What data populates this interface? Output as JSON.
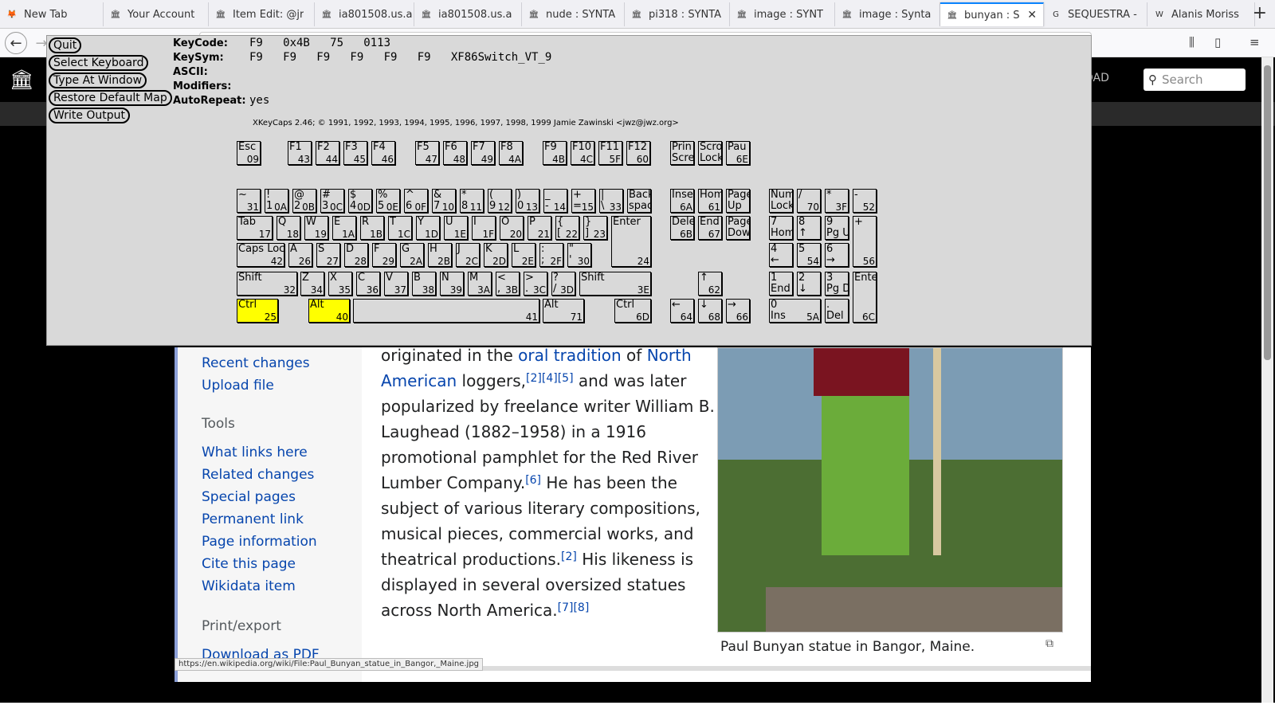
{
  "tabs": [
    {
      "label": "New Tab",
      "icon": "firefox-icon"
    },
    {
      "label": "Your Account",
      "icon": "archive-icon"
    },
    {
      "label": "Item Edit: @jr",
      "icon": "archive-icon"
    },
    {
      "label": "ia801508.us.a",
      "icon": "archive-icon"
    },
    {
      "label": "ia801508.us.a",
      "icon": "archive-icon"
    },
    {
      "label": "nude : SYNTA",
      "icon": "archive-icon"
    },
    {
      "label": "pi318 : SYNTA",
      "icon": "archive-icon"
    },
    {
      "label": "image : SYNT",
      "icon": "archive-icon"
    },
    {
      "label": "image : Synta",
      "icon": "archive-icon"
    },
    {
      "label": "bunyan : S",
      "icon": "archive-icon",
      "active": true
    },
    {
      "label": "SEQUESTRA -",
      "icon": "google-icon"
    },
    {
      "label": "Alanis Moriss",
      "icon": "wikipedia-icon"
    }
  ],
  "wiki": {
    "upload": "PLOAD",
    "search_placeholder": "Search"
  },
  "sidebar": {
    "items": [
      "Recent changes",
      "Upload file"
    ],
    "tools_heading": "Tools",
    "tools": [
      "What links here",
      "Related changes",
      "Special pages",
      "Permanent link",
      "Page information",
      "Cite this page",
      "Wikidata item"
    ],
    "print_heading": "Print/export",
    "print": [
      "Download as PDF"
    ]
  },
  "article": {
    "p1": "originated in the ",
    "l1": "oral tradition",
    "p2": " of ",
    "l2": "North American",
    "p3": " loggers,",
    "r1": "[2][4][5]",
    "p4": " and was later popularized by freelance writer William B. Laughead (1882–1958) in a 1916 promotional pamphlet for the Red River Lumber Company.",
    "r2": "[6]",
    "p5": " He has been the subject of various literary compositions, musical pieces, commercial works, and theatrical productions.",
    "r3": "[2]",
    "p6": " His likeness is displayed in several oversized statues across North America.",
    "r4": "[7][8]"
  },
  "caption": "Paul Bunyan statue in Bangor, Maine.",
  "status_url": "https://en.wikipedia.org/wiki/File:Paul_Bunyan_statue_in_Bangor,_Maine.jpg",
  "xkeycaps": {
    "buttons": [
      "Quit",
      "Select Keyboard",
      "Type At Window",
      "Restore Default Map",
      "Write Output"
    ],
    "info": [
      {
        "k": "KeyCode:",
        "v": "F9   0x4B   75   0113"
      },
      {
        "k": "KeySym:",
        "v": "F9   F9   F9   F9   F9   F9   XF86Switch_VT_9"
      },
      {
        "k": "ASCII:",
        "v": ""
      },
      {
        "k": "Modifiers:",
        "v": ""
      },
      {
        "k": "AutoRepeat:",
        "v": "yes"
      }
    ],
    "credit": "XKeyCaps 2.46; © 1991, 1992, 1993, 1994, 1995, 1996, 1997, 1998, 1999 Jamie Zawinski <jwz@jwz.org>",
    "keys": [
      {
        "l": "Esc",
        "c": "09"
      },
      {
        "l": "F1",
        "c": "43"
      },
      {
        "l": "F2",
        "c": "44"
      },
      {
        "l": "F3",
        "c": "45"
      },
      {
        "l": "F4",
        "c": "46"
      },
      {
        "l": "F5",
        "c": "47"
      },
      {
        "l": "F6",
        "c": "48"
      },
      {
        "l": "F7",
        "c": "49"
      },
      {
        "l": "F8",
        "c": "4A"
      },
      {
        "l": "F9",
        "c": "4B"
      },
      {
        "l": "F10",
        "c": "4C"
      },
      {
        "l": "F11",
        "c": "5F"
      },
      {
        "l": "F12",
        "c": "60"
      },
      {
        "l": "Prin\nScre",
        "c": ""
      },
      {
        "l": "Scro\nLock",
        "c": ""
      },
      {
        "l": "Pau",
        "c": "6E"
      },
      {
        "l": "~",
        "c": "31"
      },
      {
        "l": "!\n1",
        "c": "0A"
      },
      {
        "l": "@\n2",
        "c": "0B"
      },
      {
        "l": "#\n3",
        "c": "0C"
      },
      {
        "l": "$\n4",
        "c": "0D"
      },
      {
        "l": "%\n5",
        "c": "0E"
      },
      {
        "l": "^\n6",
        "c": "0F"
      },
      {
        "l": "&\n7",
        "c": "10"
      },
      {
        "l": "*\n8",
        "c": "11"
      },
      {
        "l": "(\n9",
        "c": "12"
      },
      {
        "l": ")\n0",
        "c": "13"
      },
      {
        "l": "_\n-",
        "c": "14"
      },
      {
        "l": "+\n=",
        "c": "15"
      },
      {
        "l": "|\n\\",
        "c": "33"
      },
      {
        "l": "Back\nspac",
        "c": ""
      },
      {
        "l": "Inse",
        "c": "6A"
      },
      {
        "l": "Hom",
        "c": "61"
      },
      {
        "l": "Page\nUp",
        "c": ""
      },
      {
        "l": "Num\nLock",
        "c": ""
      },
      {
        "l": "/",
        "c": "70"
      },
      {
        "l": "*",
        "c": "3F"
      },
      {
        "l": "-",
        "c": "52"
      },
      {
        "l": "Tab",
        "c": "17"
      },
      {
        "l": "Q",
        "c": "18"
      },
      {
        "l": "W",
        "c": "19"
      },
      {
        "l": "E",
        "c": "1A"
      },
      {
        "l": "R",
        "c": "1B"
      },
      {
        "l": "T",
        "c": "1C"
      },
      {
        "l": "Y",
        "c": "1D"
      },
      {
        "l": "U",
        "c": "1E"
      },
      {
        "l": "I",
        "c": "1F"
      },
      {
        "l": "O",
        "c": "20"
      },
      {
        "l": "P",
        "c": "21"
      },
      {
        "l": "{\n[",
        "c": "22"
      },
      {
        "l": "}\n]",
        "c": "23"
      },
      {
        "l": "Enter",
        "c": "24"
      },
      {
        "l": "Dele",
        "c": "6B"
      },
      {
        "l": "End",
        "c": "67"
      },
      {
        "l": "Page\nDow",
        "c": ""
      },
      {
        "l": "7\nHom",
        "c": ""
      },
      {
        "l": "8\n↑",
        "c": ""
      },
      {
        "l": "9\nPg U",
        "c": ""
      },
      {
        "l": "+",
        "c": "56"
      },
      {
        "l": "Caps Loc",
        "c": "42"
      },
      {
        "l": "A",
        "c": "26"
      },
      {
        "l": "S",
        "c": "27"
      },
      {
        "l": "D",
        "c": "28"
      },
      {
        "l": "F",
        "c": "29"
      },
      {
        "l": "G",
        "c": "2A"
      },
      {
        "l": "H",
        "c": "2B"
      },
      {
        "l": "J",
        "c": "2C"
      },
      {
        "l": "K",
        "c": "2D"
      },
      {
        "l": "L",
        "c": "2E"
      },
      {
        "l": ":\n;",
        "c": "2F"
      },
      {
        "l": "\"\n'",
        "c": "30"
      },
      {
        "l": "4\n←",
        "c": ""
      },
      {
        "l": "5",
        "c": "54"
      },
      {
        "l": "6\n→",
        "c": ""
      },
      {
        "l": "Shift",
        "c": "32"
      },
      {
        "l": "Z",
        "c": "34"
      },
      {
        "l": "X",
        "c": "35"
      },
      {
        "l": "C",
        "c": "36"
      },
      {
        "l": "V",
        "c": "37"
      },
      {
        "l": "B",
        "c": "38"
      },
      {
        "l": "N",
        "c": "39"
      },
      {
        "l": "M",
        "c": "3A"
      },
      {
        "l": "<\n,",
        "c": "3B"
      },
      {
        "l": ">\n.",
        "c": "3C"
      },
      {
        "l": "?\n/",
        "c": "3D"
      },
      {
        "l": "Shift",
        "c": "3E"
      },
      {
        "l": "↑",
        "c": "62"
      },
      {
        "l": "1\nEnd",
        "c": ""
      },
      {
        "l": "2\n↓",
        "c": ""
      },
      {
        "l": "3\nPg D",
        "c": ""
      },
      {
        "l": "Ente",
        "c": "6C"
      },
      {
        "l": "Ctrl",
        "c": "25",
        "hl": true
      },
      {
        "l": "Alt",
        "c": "40",
        "hl": true
      },
      {
        "l": "",
        "c": "41"
      },
      {
        "l": "Alt",
        "c": "71"
      },
      {
        "l": "Ctrl",
        "c": "6D"
      },
      {
        "l": "←",
        "c": "64"
      },
      {
        "l": "↓",
        "c": "68"
      },
      {
        "l": "→",
        "c": "66"
      },
      {
        "l": "0\nIns",
        "c": "5A"
      },
      {
        "l": ".\nDel",
        "c": ""
      }
    ]
  }
}
